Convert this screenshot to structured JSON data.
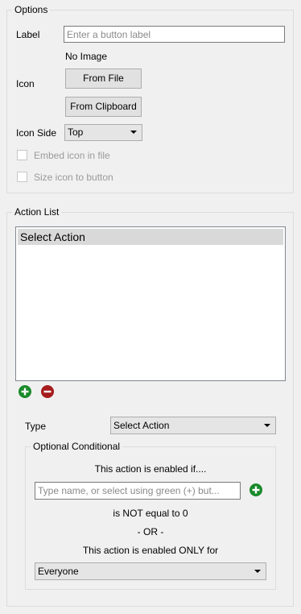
{
  "options": {
    "legend": "Options",
    "label_caption": "Label",
    "label_placeholder": "Enter a button label",
    "no_image_text": "No Image",
    "icon_caption": "Icon",
    "from_file_button": "From File",
    "from_clipboard_button": "From Clipboard",
    "icon_side_caption": "Icon Side",
    "icon_side_value": "Top",
    "embed_icon_label": "Embed icon in file",
    "size_icon_label": "Size icon to button"
  },
  "action_list": {
    "legend": "Action List",
    "items": [
      "Select Action"
    ],
    "type_caption": "Type",
    "type_value": "Select Action"
  },
  "conditional": {
    "legend": "Optional Conditional",
    "enabled_if_text": "This action is enabled if....",
    "name_placeholder": "Type name, or select using green (+) but...",
    "not_equal_text": "is NOT equal to 0",
    "or_text": "- OR -",
    "enabled_only_text": "This action is enabled ONLY for",
    "audience_value": "Everyone"
  },
  "colors": {
    "add_green": "#1a8a2a",
    "remove_red": "#a51c1c"
  }
}
